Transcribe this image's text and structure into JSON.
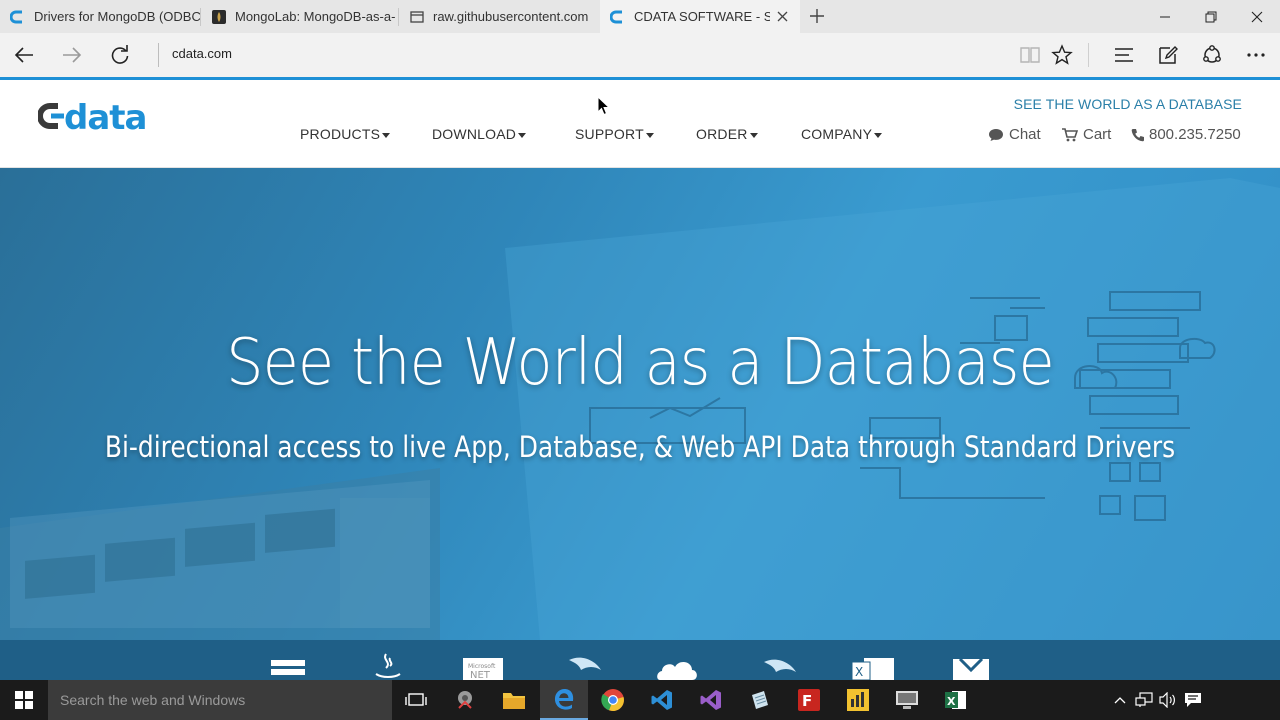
{
  "browser": {
    "tabs": [
      {
        "label": "Drivers for MongoDB (ODBC",
        "icon": "cdata-icon"
      },
      {
        "label": "MongoLab: MongoDB-as-a-",
        "icon": "mongolab-icon"
      },
      {
        "label": "raw.githubusercontent.com",
        "icon": "page-icon"
      },
      {
        "label": "CDATA SOFTWARE - See",
        "icon": "cdata-icon"
      }
    ],
    "address": "cdata.com"
  },
  "site": {
    "tagline": "SEE THE WORLD AS A DATABASE",
    "menu": [
      "PRODUCTS",
      "DOWNLOAD",
      "SUPPORT",
      "ORDER",
      "COMPANY"
    ],
    "chat": "Chat",
    "cart": "Cart",
    "phone": "800.235.7250"
  },
  "hero": {
    "title": "See the World as a Database",
    "subtitle": "Bi-directional access to live App, Database, & Web API Data through Standard Drivers"
  },
  "taskbar": {
    "search_placeholder": "Search the web and Windows"
  },
  "colors": {
    "accent": "#1e90d6",
    "tagline": "#2a7fa8",
    "hero": "#2f86b9"
  }
}
